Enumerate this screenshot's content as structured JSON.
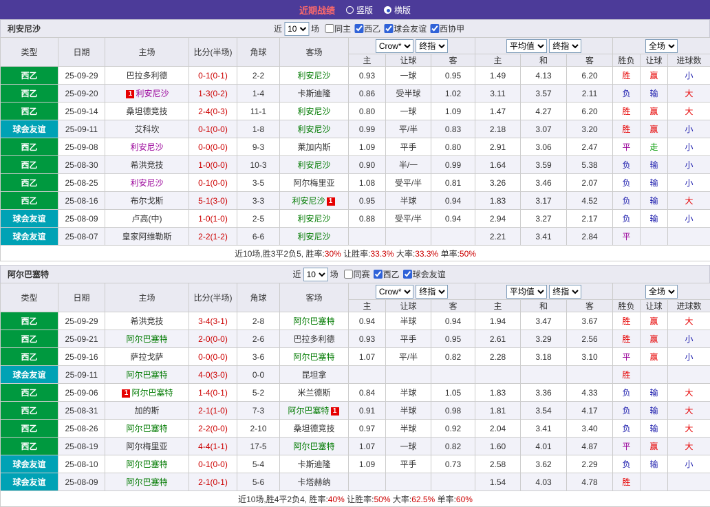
{
  "topbar": {
    "title": "近期战绩",
    "vertical": "竖版",
    "horizontal": "横版",
    "selected": "横版"
  },
  "labels": {
    "near": "近",
    "games_suffix": "场"
  },
  "columns": {
    "type": "类型",
    "date": "日期",
    "home": "主场",
    "score": "比分(半场)",
    "corner": "角球",
    "away": "客场",
    "odds": [
      "主",
      "让球",
      "客"
    ],
    "avg": [
      "主",
      "和",
      "客"
    ],
    "result": [
      "胜负",
      "让球",
      "进球数"
    ]
  },
  "dropdowns": {
    "odds_company": "Crow*",
    "odds_stage": "终指",
    "avg_source": "平均值",
    "avg_stage": "终指",
    "scope": "全场"
  },
  "colors": {
    "league_type": {
      "西乙": "#00993f",
      "球会友谊": "#00a2b5"
    },
    "result": {
      "胜": "#e60000",
      "赢": "#e60000",
      "大": "#e60000",
      "负": "#1414aa",
      "输": "#1414aa",
      "小": "#1414aa",
      "平": "#990099",
      "走": "#009900"
    },
    "team": {
      "green": "#007a00",
      "purple": "#990099",
      "black": "#333333"
    },
    "score": "#cc0000"
  },
  "sections": [
    {
      "team": "利安尼沙",
      "filter": {
        "games": "10",
        "checkboxes": [
          {
            "label": "同主",
            "checked": false
          },
          {
            "label": "西乙",
            "checked": true
          },
          {
            "label": "球会友谊",
            "checked": true
          },
          {
            "label": "西协甲",
            "checked": true
          }
        ]
      },
      "rows": [
        {
          "type": "西乙",
          "date": "25-09-29",
          "home": {
            "name": "巴拉多利德",
            "color": "black"
          },
          "score": "0-1(0-1)",
          "corner": "2-2",
          "away": {
            "name": "利安尼沙",
            "color": "green"
          },
          "odds": [
            "0.93",
            "一球",
            "0.95"
          ],
          "avg": [
            "1.49",
            "4.13",
            "6.20"
          ],
          "result": [
            "胜",
            "赢",
            "小"
          ]
        },
        {
          "type": "西乙",
          "date": "25-09-20",
          "home": {
            "name": "利安尼沙",
            "color": "purple",
            "badge": "1"
          },
          "score": "1-3(0-2)",
          "corner": "1-4",
          "away": {
            "name": "卡斯迪隆",
            "color": "black"
          },
          "odds": [
            "0.86",
            "受半球",
            "1.02"
          ],
          "avg": [
            "3.11",
            "3.57",
            "2.11"
          ],
          "result": [
            "负",
            "输",
            "大"
          ]
        },
        {
          "type": "西乙",
          "date": "25-09-14",
          "home": {
            "name": "桑坦德竞技",
            "color": "black"
          },
          "score": "2-4(0-3)",
          "corner": "11-1",
          "away": {
            "name": "利安尼沙",
            "color": "green"
          },
          "odds": [
            "0.80",
            "一球",
            "1.09"
          ],
          "avg": [
            "1.47",
            "4.27",
            "6.20"
          ],
          "result": [
            "胜",
            "赢",
            "大"
          ]
        },
        {
          "type": "球会友谊",
          "date": "25-09-11",
          "home": {
            "name": "艾科坎",
            "color": "black"
          },
          "score": "0-1(0-0)",
          "corner": "1-8",
          "away": {
            "name": "利安尼沙",
            "color": "green"
          },
          "odds": [
            "0.99",
            "平/半",
            "0.83"
          ],
          "avg": [
            "2.18",
            "3.07",
            "3.20"
          ],
          "result": [
            "胜",
            "赢",
            "小"
          ]
        },
        {
          "type": "西乙",
          "date": "25-09-08",
          "home": {
            "name": "利安尼沙",
            "color": "purple"
          },
          "score": "0-0(0-0)",
          "corner": "9-3",
          "away": {
            "name": "莱加内斯",
            "color": "black"
          },
          "odds": [
            "1.09",
            "平手",
            "0.80"
          ],
          "avg": [
            "2.91",
            "3.06",
            "2.47"
          ],
          "result": [
            "平",
            "走",
            "小"
          ]
        },
        {
          "type": "西乙",
          "date": "25-08-30",
          "home": {
            "name": "希洪竞技",
            "color": "black"
          },
          "score": "1-0(0-0)",
          "corner": "10-3",
          "away": {
            "name": "利安尼沙",
            "color": "green"
          },
          "odds": [
            "0.90",
            "半/一",
            "0.99"
          ],
          "avg": [
            "1.64",
            "3.59",
            "5.38"
          ],
          "result": [
            "负",
            "输",
            "小"
          ]
        },
        {
          "type": "西乙",
          "date": "25-08-25",
          "home": {
            "name": "利安尼沙",
            "color": "purple"
          },
          "score": "0-1(0-0)",
          "corner": "3-5",
          "away": {
            "name": "阿尔梅里亚",
            "color": "black"
          },
          "odds": [
            "1.08",
            "受平/半",
            "0.81"
          ],
          "avg": [
            "3.26",
            "3.46",
            "2.07"
          ],
          "result": [
            "负",
            "输",
            "小"
          ]
        },
        {
          "type": "西乙",
          "date": "25-08-16",
          "home": {
            "name": "布尔戈斯",
            "color": "black"
          },
          "score": "5-1(3-0)",
          "corner": "3-3",
          "away": {
            "name": "利安尼沙",
            "color": "green",
            "badge": "1"
          },
          "odds": [
            "0.95",
            "半球",
            "0.94"
          ],
          "avg": [
            "1.83",
            "3.17",
            "4.52"
          ],
          "result": [
            "负",
            "输",
            "大"
          ]
        },
        {
          "type": "球会友谊",
          "date": "25-08-09",
          "home": {
            "name": "卢高(中)",
            "color": "black"
          },
          "score": "1-0(1-0)",
          "corner": "2-5",
          "away": {
            "name": "利安尼沙",
            "color": "green"
          },
          "odds": [
            "0.88",
            "受平/半",
            "0.94"
          ],
          "avg": [
            "2.94",
            "3.27",
            "2.17"
          ],
          "result": [
            "负",
            "输",
            "小"
          ]
        },
        {
          "type": "球会友谊",
          "date": "25-08-07",
          "home": {
            "name": "皇家阿维勒斯",
            "color": "black"
          },
          "score": "2-2(1-2)",
          "corner": "6-6",
          "away": {
            "name": "利安尼沙",
            "color": "green"
          },
          "odds": [
            "",
            "",
            ""
          ],
          "avg": [
            "2.21",
            "3.41",
            "2.84"
          ],
          "result": [
            "平",
            "",
            ""
          ]
        }
      ],
      "summary": [
        {
          "text": "近10场,胜3平2负5, ",
          "red": false
        },
        {
          "text": "胜率:",
          "red": false
        },
        {
          "text": "30%",
          "red": true
        },
        {
          "text": " 让胜率:",
          "red": false
        },
        {
          "text": "33.3%",
          "red": true
        },
        {
          "text": " 大率:",
          "red": false
        },
        {
          "text": "33.3%",
          "red": true
        },
        {
          "text": " 单率:",
          "red": false
        },
        {
          "text": "50%",
          "red": true
        }
      ]
    },
    {
      "team": "阿尔巴塞特",
      "filter": {
        "games": "10",
        "checkboxes": [
          {
            "label": "同赛",
            "checked": false
          },
          {
            "label": "西乙",
            "checked": true
          },
          {
            "label": "球会友谊",
            "checked": true
          }
        ]
      },
      "rows": [
        {
          "type": "西乙",
          "date": "25-09-29",
          "home": {
            "name": "希洪竞技",
            "color": "black"
          },
          "score": "3-4(3-1)",
          "corner": "2-8",
          "away": {
            "name": "阿尔巴塞特",
            "color": "green"
          },
          "odds": [
            "0.94",
            "半球",
            "0.94"
          ],
          "avg": [
            "1.94",
            "3.47",
            "3.67"
          ],
          "result": [
            "胜",
            "赢",
            "大"
          ]
        },
        {
          "type": "西乙",
          "date": "25-09-21",
          "home": {
            "name": "阿尔巴塞特",
            "color": "green"
          },
          "score": "2-0(0-0)",
          "corner": "2-6",
          "away": {
            "name": "巴拉多利德",
            "color": "black"
          },
          "odds": [
            "0.93",
            "平手",
            "0.95"
          ],
          "avg": [
            "2.61",
            "3.29",
            "2.56"
          ],
          "result": [
            "胜",
            "赢",
            "小"
          ]
        },
        {
          "type": "西乙",
          "date": "25-09-16",
          "home": {
            "name": "萨拉戈萨",
            "color": "black"
          },
          "score": "0-0(0-0)",
          "corner": "3-6",
          "away": {
            "name": "阿尔巴塞特",
            "color": "green"
          },
          "odds": [
            "1.07",
            "平/半",
            "0.82"
          ],
          "avg": [
            "2.28",
            "3.18",
            "3.10"
          ],
          "result": [
            "平",
            "赢",
            "小"
          ]
        },
        {
          "type": "球会友谊",
          "date": "25-09-11",
          "home": {
            "name": "阿尔巴塞特",
            "color": "green"
          },
          "score": "4-0(3-0)",
          "corner": "0-0",
          "away": {
            "name": "昆坦拿",
            "color": "black"
          },
          "odds": [
            "",
            "",
            ""
          ],
          "avg": [
            "",
            "",
            ""
          ],
          "result": [
            "胜",
            "",
            ""
          ]
        },
        {
          "type": "西乙",
          "date": "25-09-06",
          "home": {
            "name": "阿尔巴塞特",
            "color": "green",
            "badge": "1"
          },
          "score": "1-4(0-1)",
          "corner": "5-2",
          "away": {
            "name": "米兰德斯",
            "color": "black"
          },
          "odds": [
            "0.84",
            "半球",
            "1.05"
          ],
          "avg": [
            "1.83",
            "3.36",
            "4.33"
          ],
          "result": [
            "负",
            "输",
            "大"
          ]
        },
        {
          "type": "西乙",
          "date": "25-08-31",
          "home": {
            "name": "加的斯",
            "color": "black"
          },
          "score": "2-1(1-0)",
          "corner": "7-3",
          "away": {
            "name": "阿尔巴塞特",
            "color": "green",
            "badge": "1"
          },
          "odds": [
            "0.91",
            "半球",
            "0.98"
          ],
          "avg": [
            "1.81",
            "3.54",
            "4.17"
          ],
          "result": [
            "负",
            "输",
            "大"
          ]
        },
        {
          "type": "西乙",
          "date": "25-08-26",
          "home": {
            "name": "阿尔巴塞特",
            "color": "green"
          },
          "score": "2-2(0-0)",
          "corner": "2-10",
          "away": {
            "name": "桑坦德竞技",
            "color": "black"
          },
          "odds": [
            "0.97",
            "半球",
            "0.92"
          ],
          "avg": [
            "2.04",
            "3.41",
            "3.40"
          ],
          "result": [
            "负",
            "输",
            "大"
          ]
        },
        {
          "type": "西乙",
          "date": "25-08-19",
          "home": {
            "name": "阿尔梅里亚",
            "color": "black"
          },
          "score": "4-4(1-1)",
          "corner": "17-5",
          "away": {
            "name": "阿尔巴塞特",
            "color": "green"
          },
          "odds": [
            "1.07",
            "一球",
            "0.82"
          ],
          "avg": [
            "1.60",
            "4.01",
            "4.87"
          ],
          "result": [
            "平",
            "赢",
            "大"
          ]
        },
        {
          "type": "球会友谊",
          "date": "25-08-10",
          "home": {
            "name": "阿尔巴塞特",
            "color": "green"
          },
          "score": "0-1(0-0)",
          "corner": "5-4",
          "away": {
            "name": "卡斯迪隆",
            "color": "black"
          },
          "odds": [
            "1.09",
            "平手",
            "0.73"
          ],
          "avg": [
            "2.58",
            "3.62",
            "2.29"
          ],
          "result": [
            "负",
            "输",
            "小"
          ]
        },
        {
          "type": "球会友谊",
          "date": "25-08-09",
          "home": {
            "name": "阿尔巴塞特",
            "color": "green"
          },
          "score": "2-1(0-1)",
          "corner": "5-6",
          "away": {
            "name": "卡塔赫纳",
            "color": "black"
          },
          "odds": [
            "",
            "",
            ""
          ],
          "avg": [
            "1.54",
            "4.03",
            "4.78"
          ],
          "result": [
            "胜",
            "",
            ""
          ]
        }
      ],
      "summary": [
        {
          "text": "近10场,胜4平2负4, ",
          "red": false
        },
        {
          "text": "胜率:",
          "red": false
        },
        {
          "text": "40%",
          "red": true
        },
        {
          "text": " 让胜率:",
          "red": false
        },
        {
          "text": "50%",
          "red": true
        },
        {
          "text": " 大率:",
          "red": false
        },
        {
          "text": "62.5%",
          "red": true
        },
        {
          "text": " 单率:",
          "red": false
        },
        {
          "text": "60%",
          "red": true
        }
      ]
    }
  ]
}
